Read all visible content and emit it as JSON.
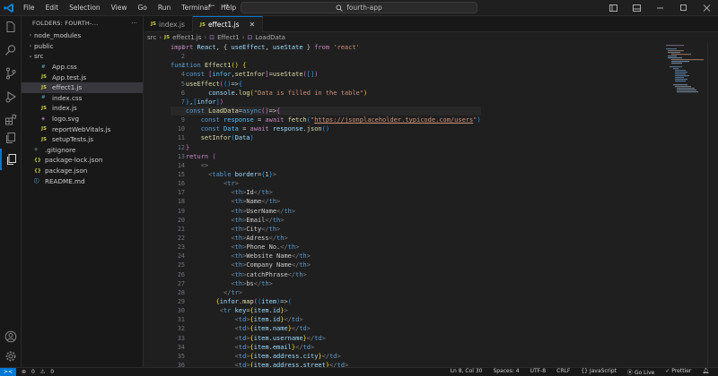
{
  "titlebar": {
    "menu": [
      "File",
      "Edit",
      "Selection",
      "View",
      "Go",
      "Run",
      "Terminal",
      "Help"
    ],
    "search_text": "fourth-app",
    "back": "←",
    "forward": "→"
  },
  "sidebar": {
    "header": "FOLDERS: FOURTH-...",
    "items": [
      {
        "label": "node_modules",
        "type": "folder",
        "indent": 1
      },
      {
        "label": "public",
        "type": "folder",
        "indent": 1
      },
      {
        "label": "src",
        "type": "folder-open",
        "indent": 1
      },
      {
        "label": "App.css",
        "type": "css",
        "indent": 2
      },
      {
        "label": "App.test.js",
        "type": "js",
        "indent": 2
      },
      {
        "label": "effect1.js",
        "type": "js",
        "indent": 2,
        "selected": true
      },
      {
        "label": "index.css",
        "type": "css",
        "indent": 2
      },
      {
        "label": "index.js",
        "type": "js",
        "indent": 2
      },
      {
        "label": "logo.svg",
        "type": "svg",
        "indent": 2
      },
      {
        "label": "reportWebVitals.js",
        "type": "js",
        "indent": 2
      },
      {
        "label": "setupTests.js",
        "type": "js",
        "indent": 2
      },
      {
        "label": ".gitignore",
        "type": "git",
        "indent": 1
      },
      {
        "label": "package-lock.json",
        "type": "json",
        "indent": 1
      },
      {
        "label": "package.json",
        "type": "json",
        "indent": 1
      },
      {
        "label": "README.md",
        "type": "md",
        "indent": 1
      }
    ]
  },
  "tabs": [
    {
      "label": "index.js",
      "active": false
    },
    {
      "label": "effect1.js",
      "active": true
    }
  ],
  "breadcrumb": [
    "src",
    "effect1.js",
    "Effect1",
    "LoadData"
  ],
  "editor": {
    "current_line": 8,
    "lines": [
      {
        "n": 1
      },
      {
        "n": 2
      },
      {
        "n": 3
      },
      {
        "n": 4
      },
      {
        "n": 5
      },
      {
        "n": 6
      },
      {
        "n": 7
      },
      {
        "n": 8
      },
      {
        "n": 9
      },
      {
        "n": 10
      },
      {
        "n": 11
      },
      {
        "n": 12
      },
      {
        "n": 13
      },
      {
        "n": 14
      },
      {
        "n": 15
      },
      {
        "n": 16
      },
      {
        "n": 17
      },
      {
        "n": 18
      },
      {
        "n": 19
      },
      {
        "n": 20
      },
      {
        "n": 21
      },
      {
        "n": 22
      },
      {
        "n": 23
      },
      {
        "n": 24
      },
      {
        "n": 25
      },
      {
        "n": 26
      },
      {
        "n": 27
      },
      {
        "n": 28
      },
      {
        "n": 29
      },
      {
        "n": 30
      },
      {
        "n": 31
      },
      {
        "n": 32
      },
      {
        "n": 33
      },
      {
        "n": 34
      },
      {
        "n": 35
      },
      {
        "n": 36
      }
    ]
  },
  "statusbar": {
    "errors": "0",
    "warnings": "0",
    "position": "Ln 8, Col 30",
    "spaces": "Spaces: 4",
    "encoding": "UTF-8",
    "eol": "CRLF",
    "language": "JavaScript",
    "golive": "Go Live",
    "prettier": "Prettier"
  },
  "colors": {
    "accent": "#0078d4",
    "keyword": "#c586c0",
    "string": "#ce9178",
    "function": "#dcdcaa",
    "variable": "#9cdcfe"
  }
}
